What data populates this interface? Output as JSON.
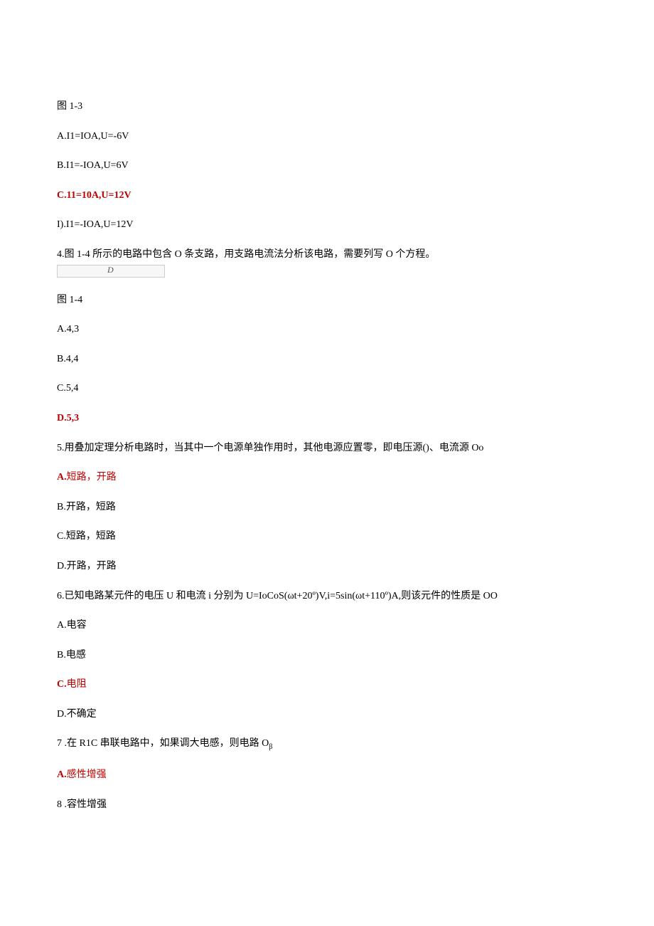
{
  "lines": [
    {
      "key": "l1",
      "text": "图 1-3",
      "cls": ""
    },
    {
      "key": "l2",
      "text": "A.I1=IOA,U=-6V",
      "cls": ""
    },
    {
      "key": "l3",
      "text": "B.I1=-IOA,U=6V",
      "cls": ""
    },
    {
      "key": "l4",
      "text": "C.11=10A,U=12V",
      "cls": "answer"
    },
    {
      "key": "l5",
      "text": "I).I1=-IOA,U=12V",
      "cls": ""
    },
    {
      "key": "l6",
      "text": "4.图 1-4 所示的电路中包含 O 条支路，用支路电流法分析该电路，需要列写 O 个方程。",
      "cls": "",
      "figure": true,
      "figLabel": "D"
    },
    {
      "key": "l7",
      "text": "图 1-4",
      "cls": ""
    },
    {
      "key": "l8",
      "text": "A.4,3",
      "cls": ""
    },
    {
      "key": "l9",
      "text": "B.4,4",
      "cls": ""
    },
    {
      "key": "l10",
      "text": "C.5,4",
      "cls": ""
    },
    {
      "key": "l11",
      "text": "D.5,3",
      "cls": "answer"
    },
    {
      "key": "l12",
      "text": "5.用叠加定理分析电路时，当其中一个电源单独作用时，其他电源应置零，即电压源()、电流源 Oo",
      "cls": ""
    },
    {
      "key": "l13",
      "prefix": "A.",
      "body": "短路，开路",
      "cls": "answer-mixed"
    },
    {
      "key": "l14",
      "text": "B.开路，短路",
      "cls": ""
    },
    {
      "key": "l15",
      "text": "C.短路，短路",
      "cls": ""
    },
    {
      "key": "l16",
      "text": "D.开路，开路",
      "cls": ""
    },
    {
      "key": "l17",
      "text": "6.已知电路某元件的电压 U 和电流 i 分别为 U=IoCoS(ωt+20º)V,i=5sin(ωt+110º)A,则该元件的性质是 OO",
      "cls": ""
    },
    {
      "key": "l18",
      "text": "A.电容",
      "cls": ""
    },
    {
      "key": "l19",
      "text": "B.电感",
      "cls": ""
    },
    {
      "key": "l20",
      "prefix": "C.",
      "body": "电阻",
      "cls": "answer-mixed"
    },
    {
      "key": "l21",
      "text": "D.不确定",
      "cls": ""
    },
    {
      "key": "l22",
      "text": "7 .在 R1C 串联电路中，如果调大电感，则电路 O",
      "suffix": "β",
      "cls": ""
    },
    {
      "key": "l23",
      "prefix": "A.",
      "body": "感性增强",
      "cls": "answer-mixed"
    },
    {
      "key": "l24",
      "text": "8 .容性增强",
      "cls": ""
    }
  ]
}
